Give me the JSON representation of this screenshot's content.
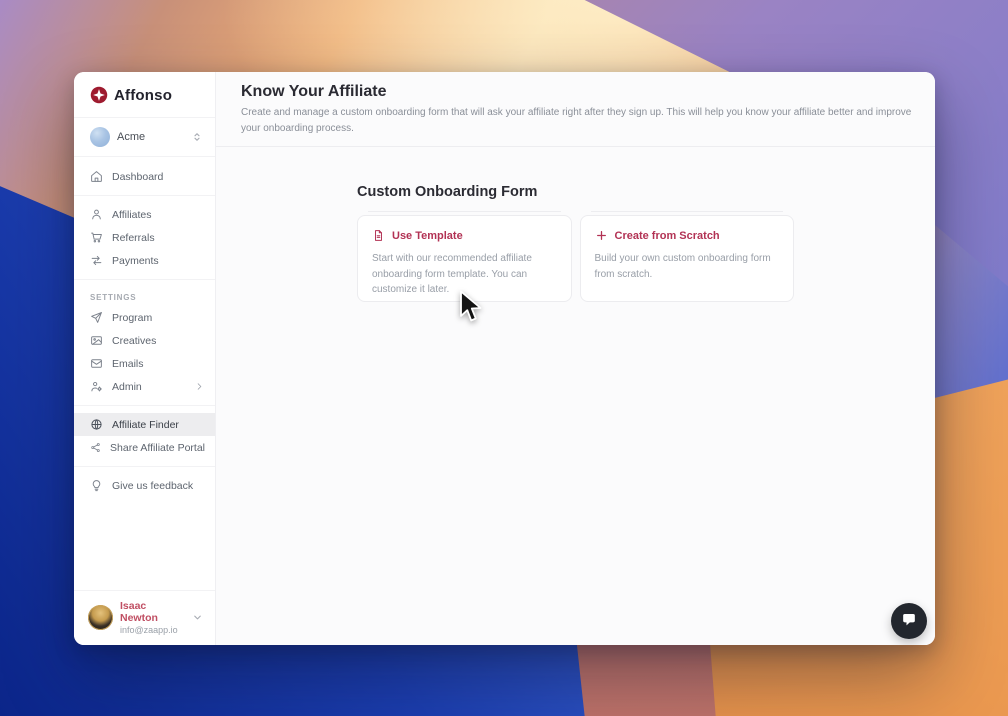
{
  "colors": {
    "accent_crimson": "#b23254",
    "logo_red": "#9e1b2f",
    "active_item_bg": "#ededef",
    "chat_button_bg": "#23272e",
    "window_bg": "#ffffff",
    "main_bg": "#fbfbfc"
  },
  "sidebar": {
    "logo_text": "Affonso",
    "workspace": {
      "name": "Acme",
      "icon": "workspace-avatar",
      "selector_icon": "chevron-up-down-icon"
    },
    "sections": [
      {
        "items": [
          {
            "id": "dashboard",
            "icon": "home-icon",
            "label": "Dashboard"
          }
        ]
      },
      {
        "items": [
          {
            "id": "affiliates",
            "icon": "users-icon",
            "label": "Affiliates"
          },
          {
            "id": "referrals",
            "icon": "cart-icon",
            "label": "Referrals"
          },
          {
            "id": "payments",
            "icon": "transfer-icon",
            "label": "Payments"
          }
        ]
      },
      {
        "label": "SETTINGS",
        "items": [
          {
            "id": "program",
            "icon": "send-icon",
            "label": "Program"
          },
          {
            "id": "creatives",
            "icon": "image-icon",
            "label": "Creatives"
          },
          {
            "id": "emails",
            "icon": "mail-icon",
            "label": "Emails"
          },
          {
            "id": "admin",
            "icon": "user-gear-icon",
            "label": "Admin",
            "chevron": true
          }
        ]
      },
      {
        "items": [
          {
            "id": "affiliate-finder",
            "icon": "globe-icon",
            "label": "Affiliate Finder",
            "active": true
          },
          {
            "id": "share-affiliate-portal",
            "icon": "share-icon",
            "label": "Share Affiliate Portal"
          }
        ]
      },
      {
        "items": [
          {
            "id": "give-us-feedback",
            "icon": "lightbulb-icon",
            "label": "Give us feedback"
          }
        ]
      }
    ],
    "user": {
      "name": "Isaac Newton",
      "email": "info@zaapp.io"
    }
  },
  "header": {
    "title": "Know Your Affiliate",
    "subtitle": "Create and manage a custom onboarding form that will ask your affiliate right after they sign up. This will help you know your affiliate better and improve your onboarding process."
  },
  "main": {
    "section_title": "Custom Onboarding Form",
    "cards": [
      {
        "id": "use-template",
        "icon": "document-icon",
        "title": "Use Template",
        "description": "Start with our recommended affiliate onboarding form template. You can customize it later."
      },
      {
        "id": "create-from-scratch",
        "icon": "plus-icon",
        "title": "Create from Scratch",
        "description": "Build your own custom onboarding form from scratch."
      }
    ]
  },
  "chat_widget": {
    "icon": "chat-bubble-icon"
  },
  "cursor": {
    "icon": "cursor-arrow"
  }
}
